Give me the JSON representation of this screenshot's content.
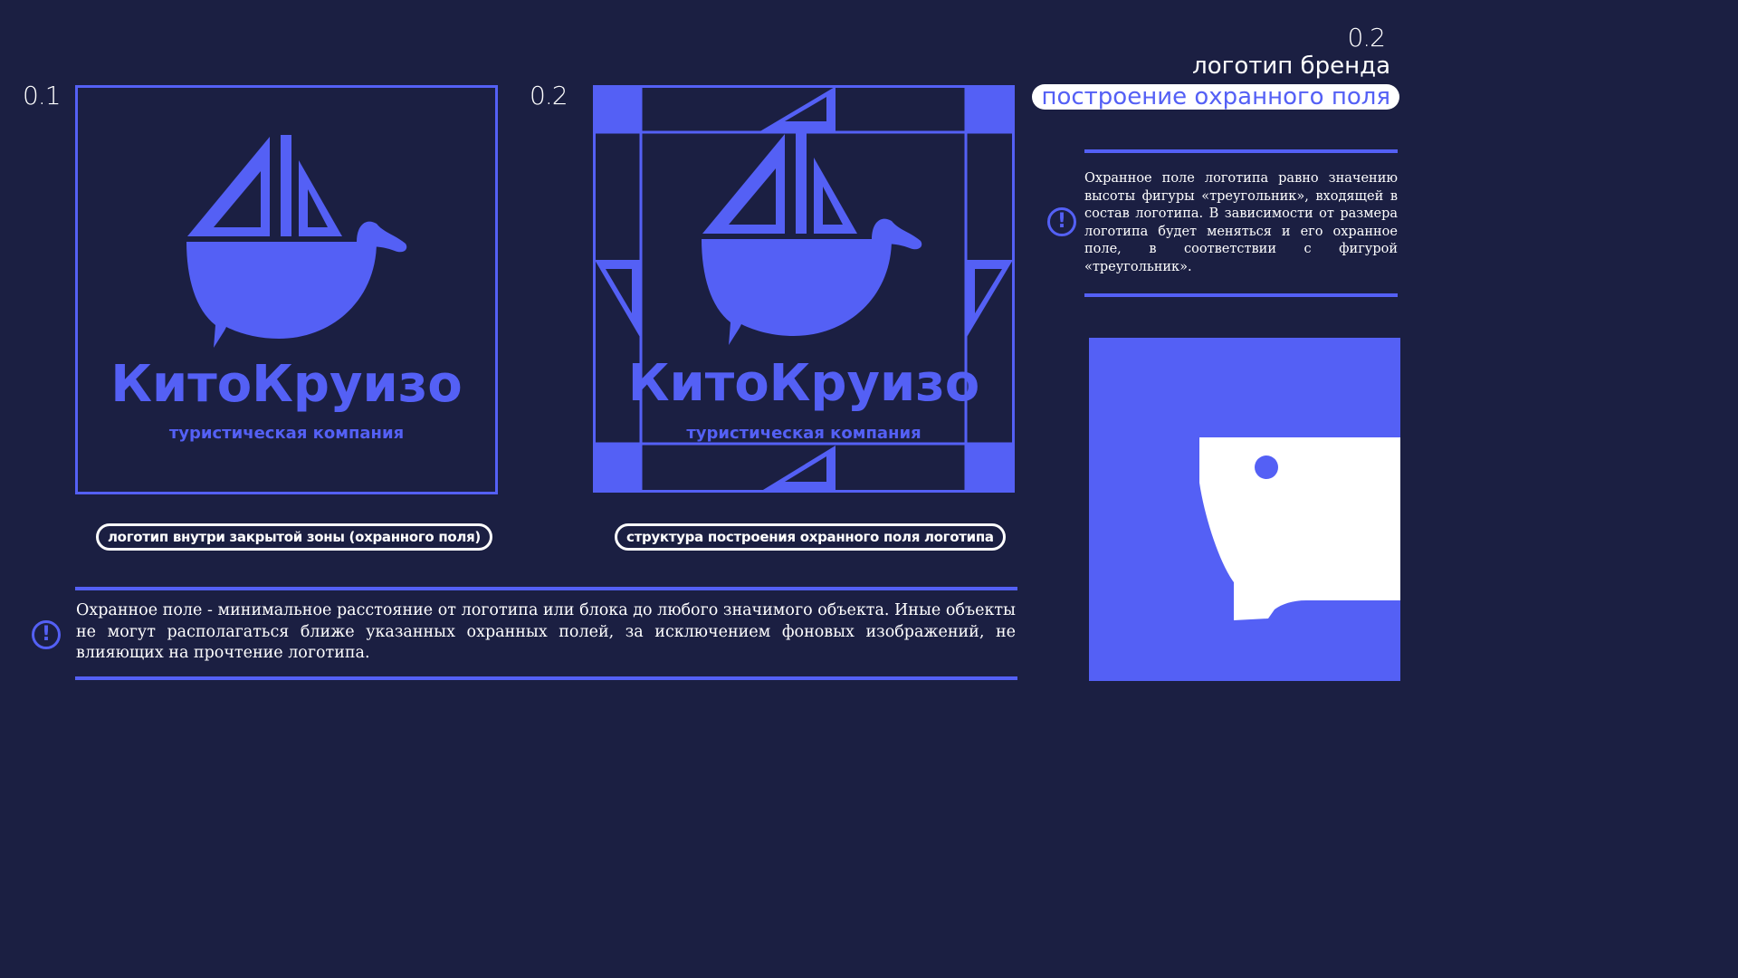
{
  "header": {
    "section_number": "0.2",
    "title": "логотип бренда",
    "subtitle": "построение охранного поля"
  },
  "panel1": {
    "number": "0.1",
    "brand_name": "КитоКруизо",
    "brand_tagline": "туристическая компания",
    "caption": "логотип внутри закрытой зоны (охранного поля)"
  },
  "panel2": {
    "number": "0.2",
    "brand_name": "КитоКруизо",
    "brand_tagline": "туристическая компания",
    "caption": "структура построения охранного поля логотипа"
  },
  "side_note": {
    "icon": "exclamation-circle-icon",
    "text": "Охранное поле логотипа равно значению высоты фигуры «треугольник», входящей в состав логотипа. В зависимости от размера логотипа будет меняться и его охранное поле, в соответствии с фигурой «треугольник»."
  },
  "bottom_note": {
    "icon": "exclamation-circle-icon",
    "text": "Охранное поле - минимальное расстояние от логотипа или блока до любого значимого объекта. Иные объекты не могут располагаться ближе указанных охранных полей, за исключением фоновых изображений, не влияющих на прочтение логотипа."
  },
  "colors": {
    "background": "#1b1f42",
    "accent": "#5460f5",
    "text": "#ffffff"
  }
}
